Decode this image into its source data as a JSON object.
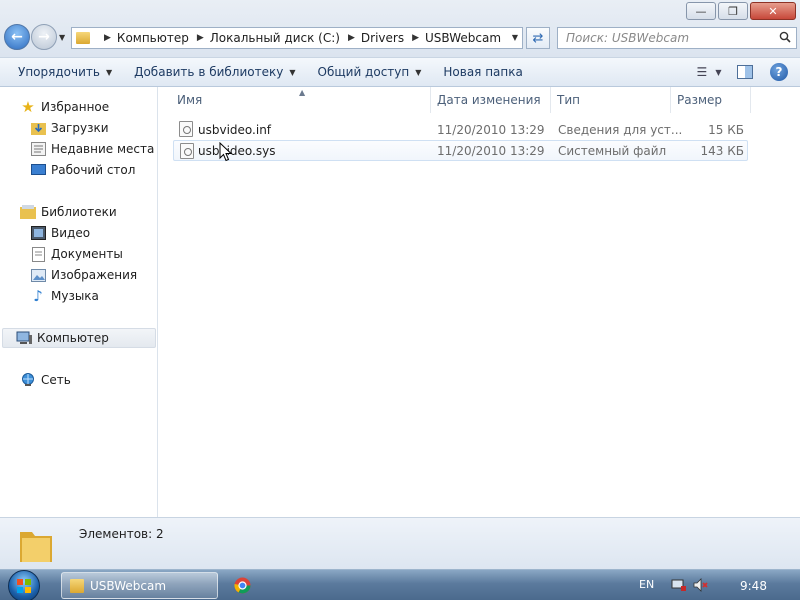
{
  "window": {
    "minimize_glyph": "—",
    "maximize_glyph": "❐",
    "close_glyph": "✕"
  },
  "address": {
    "crumbs": [
      "Компьютер",
      "Локальный диск (C:)",
      "Drivers",
      "USBWebcam"
    ],
    "search_placeholder": "Поиск: USBWebcam"
  },
  "toolbar": {
    "organize": "Упорядочить",
    "add_to_library": "Добавить в библиотеку",
    "share": "Общий доступ",
    "new_folder": "Новая папка"
  },
  "sidebar": {
    "favorites": "Избранное",
    "downloads": "Загрузки",
    "recent": "Недавние места",
    "desktop": "Рабочий стол",
    "libraries": "Библиотеки",
    "video": "Видео",
    "documents": "Документы",
    "images": "Изображения",
    "music": "Музыка",
    "computer": "Компьютер",
    "network": "Сеть"
  },
  "columns": {
    "name": "Имя",
    "date": "Дата изменения",
    "type": "Тип",
    "size": "Размер"
  },
  "files": [
    {
      "name": "usbvideo.inf",
      "date": "11/20/2010 13:29",
      "type": "Сведения для уст...",
      "size": "15 КБ"
    },
    {
      "name": "usbvideo.sys",
      "date": "11/20/2010 13:29",
      "type": "Системный файл",
      "size": "143 КБ"
    }
  ],
  "details": {
    "item_count": "Элементов: 2"
  },
  "taskbar": {
    "window_label": "USBWebcam",
    "language": "EN",
    "time": "9:48"
  }
}
